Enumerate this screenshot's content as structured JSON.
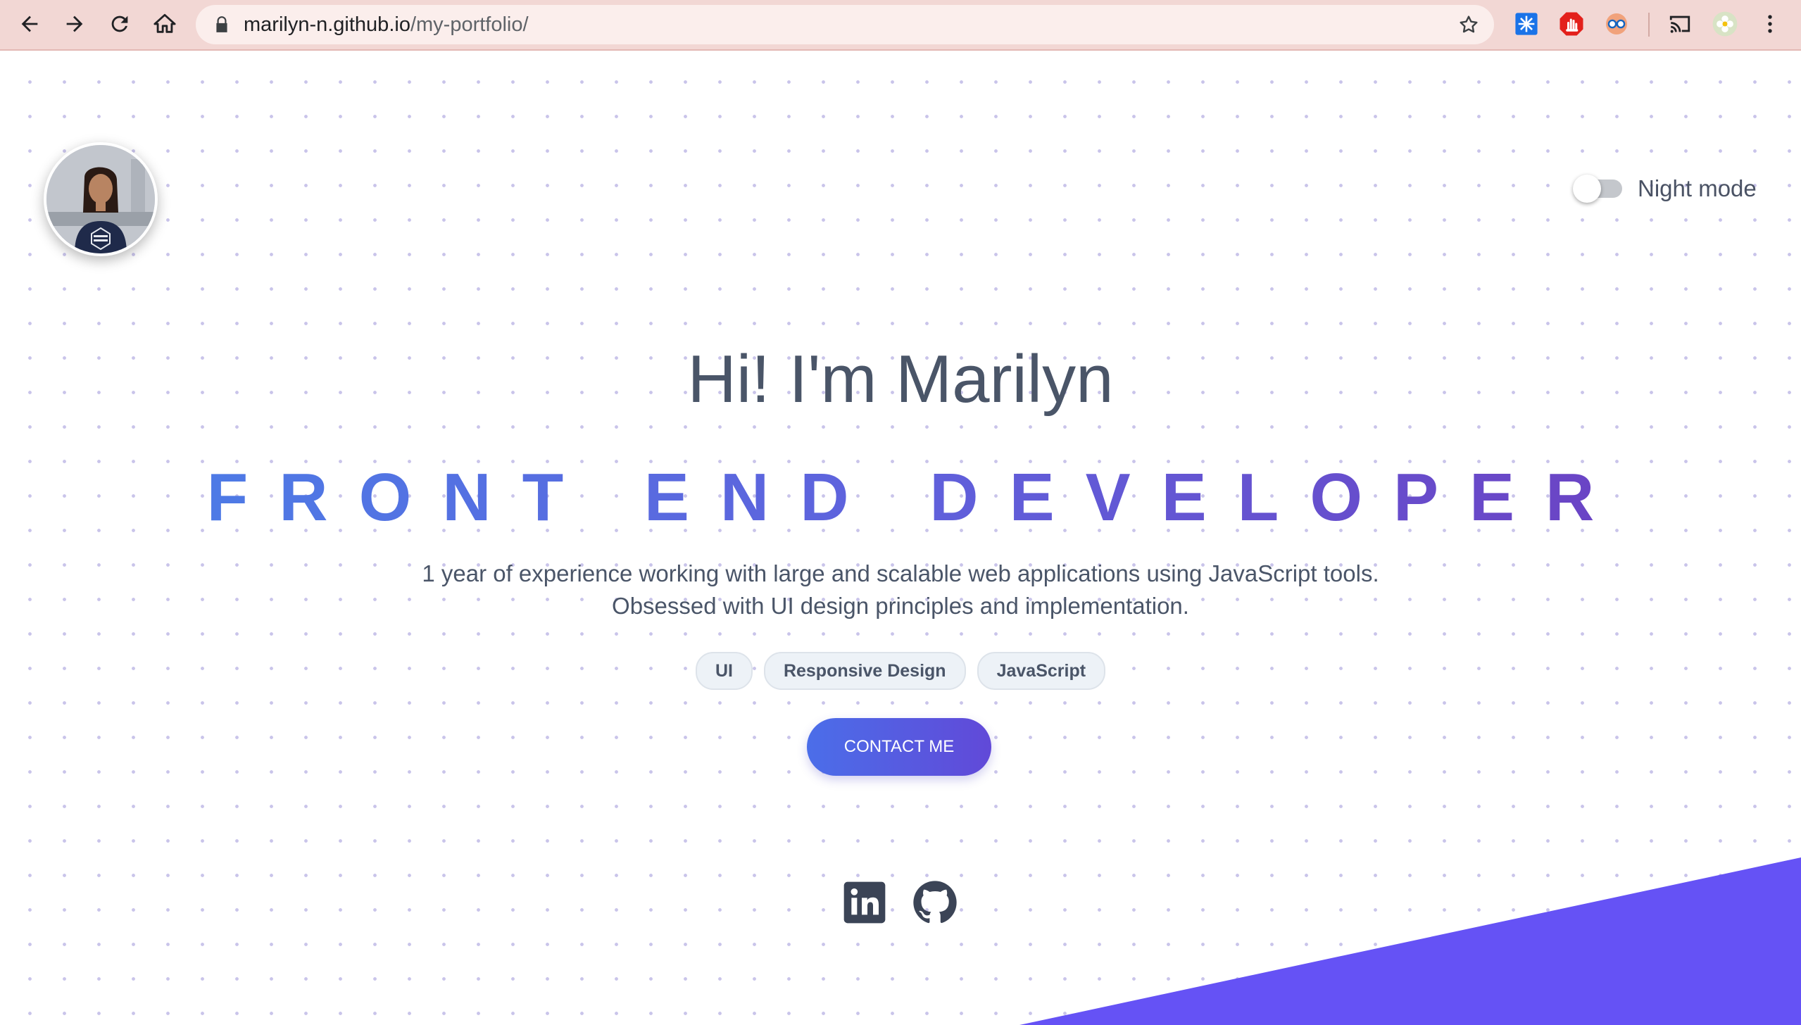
{
  "browser": {
    "url_domain": "marilyn-n.github.io",
    "url_path": "/my-portfolio/",
    "icons": [
      "back-arrow-icon",
      "forward-arrow-icon",
      "reload-icon",
      "home-icon",
      "lock-icon",
      "bookmark-star-icon",
      "extension-snowflake-icon",
      "adblock-hand-icon",
      "extension-glasses-icon",
      "cast-icon",
      "profile-avatar-icon",
      "menu-kebab-icon"
    ]
  },
  "header": {
    "night_mode_label": "Night mode",
    "night_mode_on": false
  },
  "hero": {
    "greeting": "Hi! I'm Marilyn",
    "role": "FRONT END DEVELOPER",
    "description_line1": "1 year of experience working with large and scalable web applications using JavaScript tools.",
    "description_line2": "Obsessed with UI design principles and implementation.",
    "tags": [
      "UI",
      "Responsive Design",
      "JavaScript"
    ],
    "contact_label": "CONTACT ME"
  },
  "social": {
    "icons": [
      "linkedin-icon",
      "github-icon"
    ]
  },
  "colors": {
    "accent_blue": "#4d7be6",
    "accent_purple": "#6b43c4",
    "wedge": "#6552f5",
    "text": "#4a5568"
  }
}
